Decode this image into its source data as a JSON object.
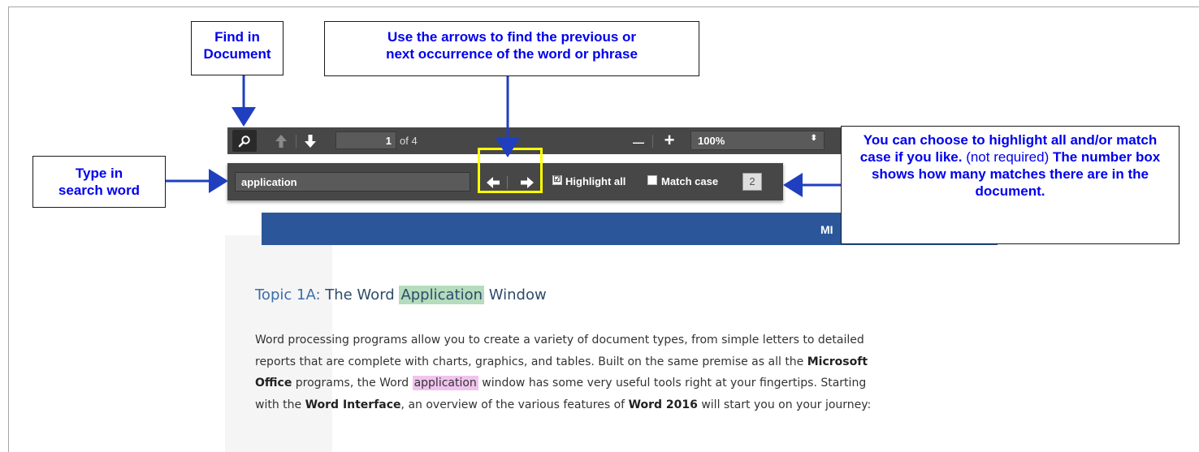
{
  "toolbar": {
    "page_number": "1",
    "page_of": "of 4",
    "zoom_minus": "—",
    "zoom_plus": "+",
    "zoom_value": "100%",
    "zoom_caret": "⬍"
  },
  "findbar": {
    "search_value": "application",
    "highlight_all_label": "Highlight all",
    "highlight_all_checked": "☑",
    "match_case_label": "Match case",
    "match_count": "2"
  },
  "document": {
    "banner_text": "MI",
    "topic_lead": "Topic 1A:",
    "topic_pre": " The Word ",
    "topic_hl": "Application",
    "topic_post": " Window",
    "para": {
      "s1": "Word processing programs allow you to create a variety of document types, from simple letters to detailed reports that are complete with charts, graphics, and tables.  Built on the same premise as all the ",
      "b1": "Microsoft Office",
      "s2": " programs, the Word ",
      "hl": "application",
      "s3": " window has some very useful tools right at your fingertips. Starting with the ",
      "b2": "Word Interface",
      "s4": ", an overview of the various features of ",
      "b3": "Word 2016",
      "s5": " will start you on your journey:"
    }
  },
  "callouts": {
    "find_line1": "Find in",
    "find_line2": "Document",
    "arrows_line1": "Use the arrows to find the previous or",
    "arrows_line2": "next occurrence of the word or phrase",
    "type_line1": "Type in",
    "type_line2": "search word",
    "highlight_bold1": "You can choose to highlight all and/or match case if you like.",
    "highlight_normal": "  (not required)",
    "highlight_bold2": " The number box shows how many matches there are in the document."
  },
  "colors": {
    "toolbar_bg": "#474747",
    "banner": "#2b579a",
    "callout_text": "#0000ee",
    "arrow": "#1f3fbf",
    "highlight_box": "#ffff00"
  }
}
